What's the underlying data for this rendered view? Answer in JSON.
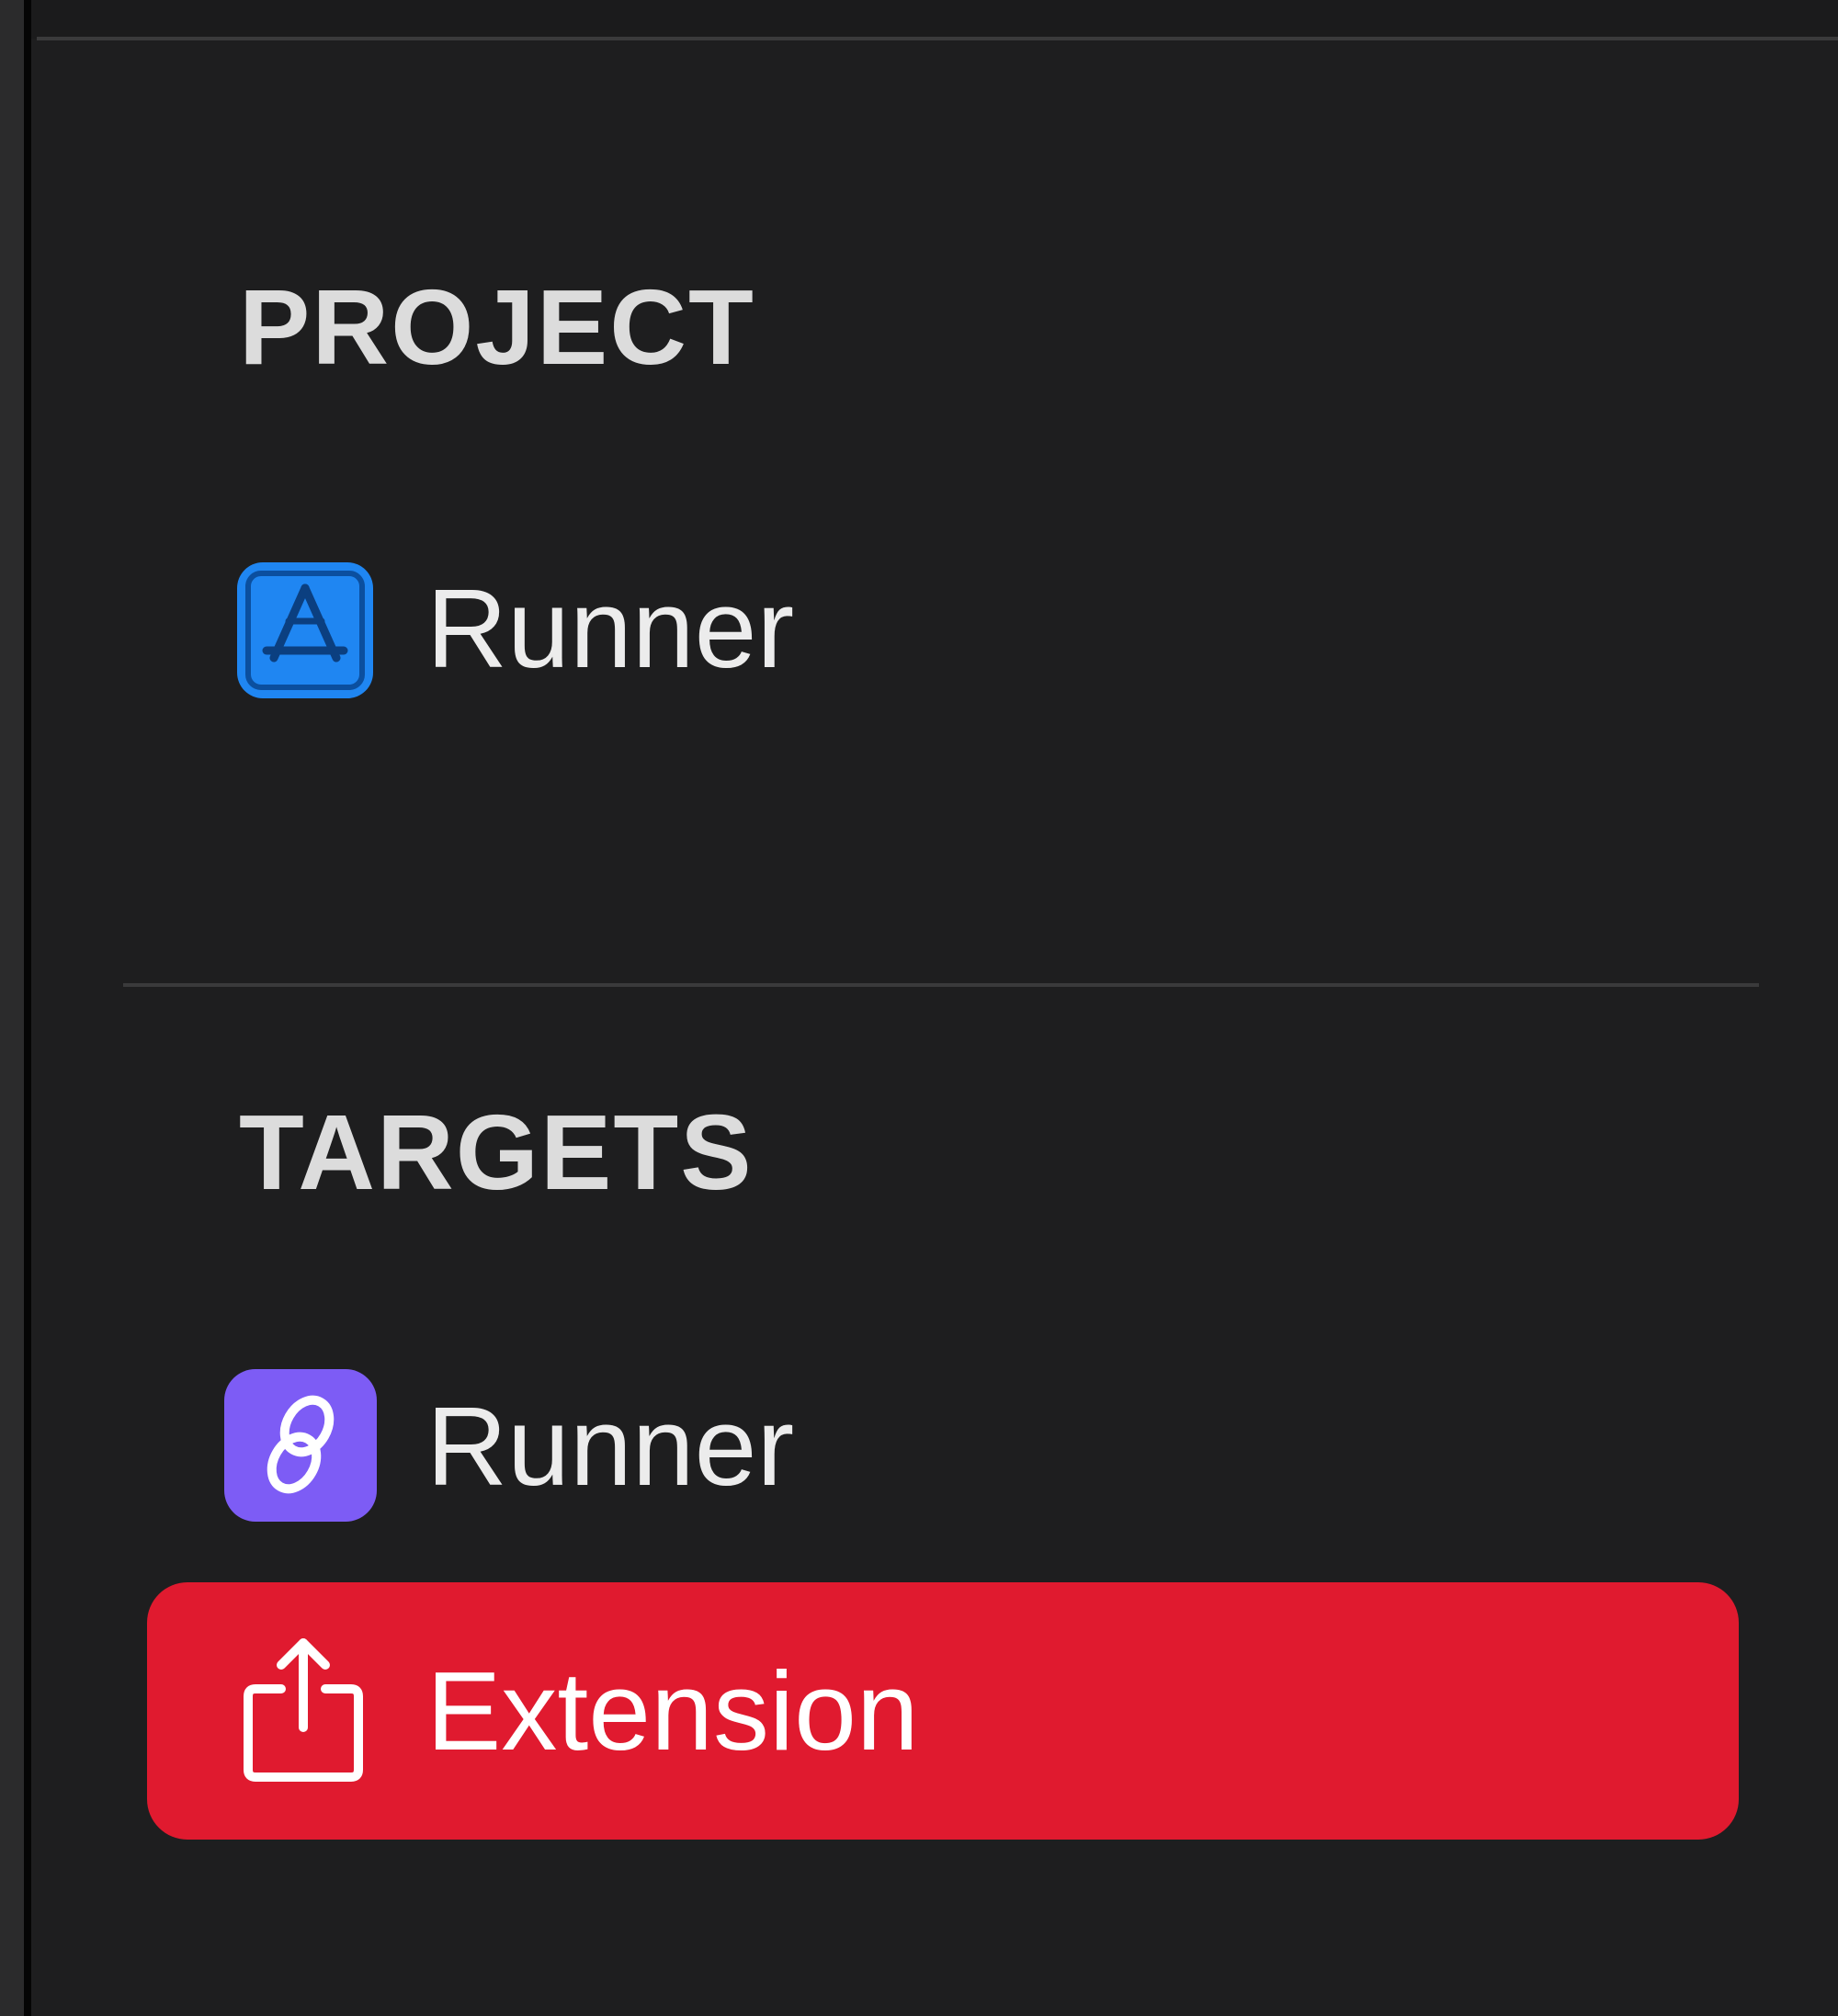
{
  "sections": {
    "project": {
      "header": "PROJECT",
      "items": [
        {
          "label": "Runner",
          "icon": "xcode-project-icon"
        }
      ]
    },
    "targets": {
      "header": "TARGETS",
      "items": [
        {
          "label": "Runner",
          "icon": "flutter-app-target-icon"
        },
        {
          "label": "Extension",
          "icon": "share-extension-icon",
          "selected": true
        }
      ]
    }
  },
  "colors": {
    "background": "#1e1e1f",
    "selection": "#e01a2f",
    "project_icon": "#1f86f2",
    "target_icon": "#7d5cf5"
  }
}
